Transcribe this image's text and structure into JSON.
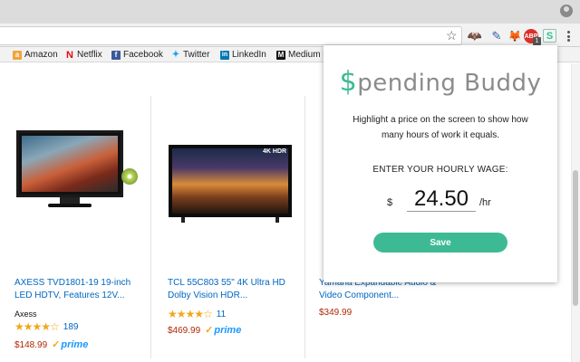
{
  "browser": {
    "bookmarks": [
      {
        "label": "Amazon",
        "icon": "amazon-icon",
        "glyph": "a"
      },
      {
        "label": "Netflix",
        "icon": "netflix-icon",
        "glyph": "N"
      },
      {
        "label": "Facebook",
        "icon": "facebook-icon",
        "glyph": "f"
      },
      {
        "label": "Twitter",
        "icon": "twitter-icon",
        "glyph": "🐦"
      },
      {
        "label": "LinkedIn",
        "icon": "linkedin-icon",
        "glyph": "in"
      },
      {
        "label": "Medium",
        "icon": "medium-icon",
        "glyph": "M"
      }
    ],
    "extensions": {
      "abp_badge": "1"
    }
  },
  "products": [
    {
      "title": "AXESS TVD1801-19 19-inch LED HDTV, Features 12V...",
      "brand": "Axess",
      "rating": 3.5,
      "stars": "★★★★☆",
      "reviews": "189",
      "price": "$148.99",
      "prime": "prime"
    },
    {
      "title": "TCL 55C803 55\" 4K Ultra HD Dolby Vision HDR...",
      "brand": "",
      "rating": 3.5,
      "stars": "★★★★☆",
      "reviews": "11",
      "price": "$469.99",
      "prime": "prime",
      "badge": "4K HDR"
    },
    {
      "title": "Yamaha Expandable Audio & Video Component...",
      "price": "$349.99"
    }
  ],
  "popup": {
    "logo_s": "$",
    "logo_rest": "pending Buddy",
    "message": "Highlight a price on the screen to show how many hours of work it equals.",
    "label": "ENTER YOUR HOURLY WAGE:",
    "currency": "$",
    "wage_value": "24.50",
    "unit": "/hr",
    "save_label": "Save"
  },
  "colors": {
    "accent": "#3dba94",
    "link": "#0066c0",
    "price": "#b12704",
    "star": "#f0a81c",
    "prime": "#1a98ff"
  }
}
